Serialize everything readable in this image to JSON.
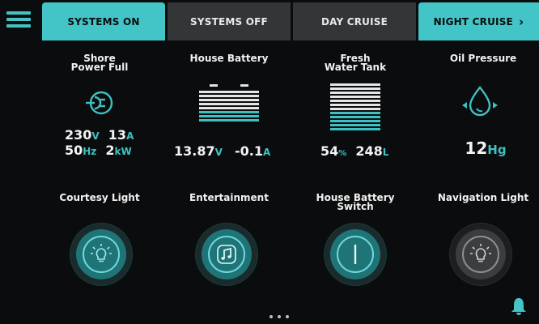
{
  "tabs": [
    {
      "label": "SYSTEMS ON",
      "active": true
    },
    {
      "label": "SYSTEMS OFF",
      "active": false
    },
    {
      "label": "DAY CRUISE",
      "active": false
    },
    {
      "label": "NIGHT CRUISE",
      "active": true
    }
  ],
  "gauges": {
    "shore": {
      "title_l1": "Shore",
      "title_l2": "Power Full",
      "voltage": "230",
      "voltage_unit": "V",
      "current": "13",
      "current_unit": "A",
      "frequency": "50",
      "frequency_unit": "Hz",
      "power": "2",
      "power_unit": "kW"
    },
    "house_battery": {
      "title": "House Battery",
      "voltage": "13.87",
      "voltage_unit": "V",
      "current": "-0.1",
      "current_unit": "A"
    },
    "fresh_water": {
      "title_l1": "Fresh",
      "title_l2": "Water Tank",
      "level": "54",
      "level_unit": "%",
      "volume": "248",
      "volume_unit": "L"
    },
    "oil": {
      "title": "Oil Pressure",
      "value": "12",
      "unit": "Hg"
    }
  },
  "switches": [
    {
      "title_l1": "Courtesy Light",
      "title_l2": "",
      "state": "on",
      "icon": "lightbulb-icon"
    },
    {
      "title_l1": "Entertainment",
      "title_l2": "",
      "state": "on",
      "icon": "music-note-icon"
    },
    {
      "title_l1": "House Battery",
      "title_l2": "Switch",
      "state": "on",
      "icon": "power-switch-icon"
    },
    {
      "title_l1": "Navigation Light",
      "title_l2": "",
      "state": "off",
      "icon": "lightbulb-icon"
    }
  ],
  "colors": {
    "accent": "#43c4c7",
    "background": "#0b0c0d",
    "inactive_tab": "#343536"
  }
}
